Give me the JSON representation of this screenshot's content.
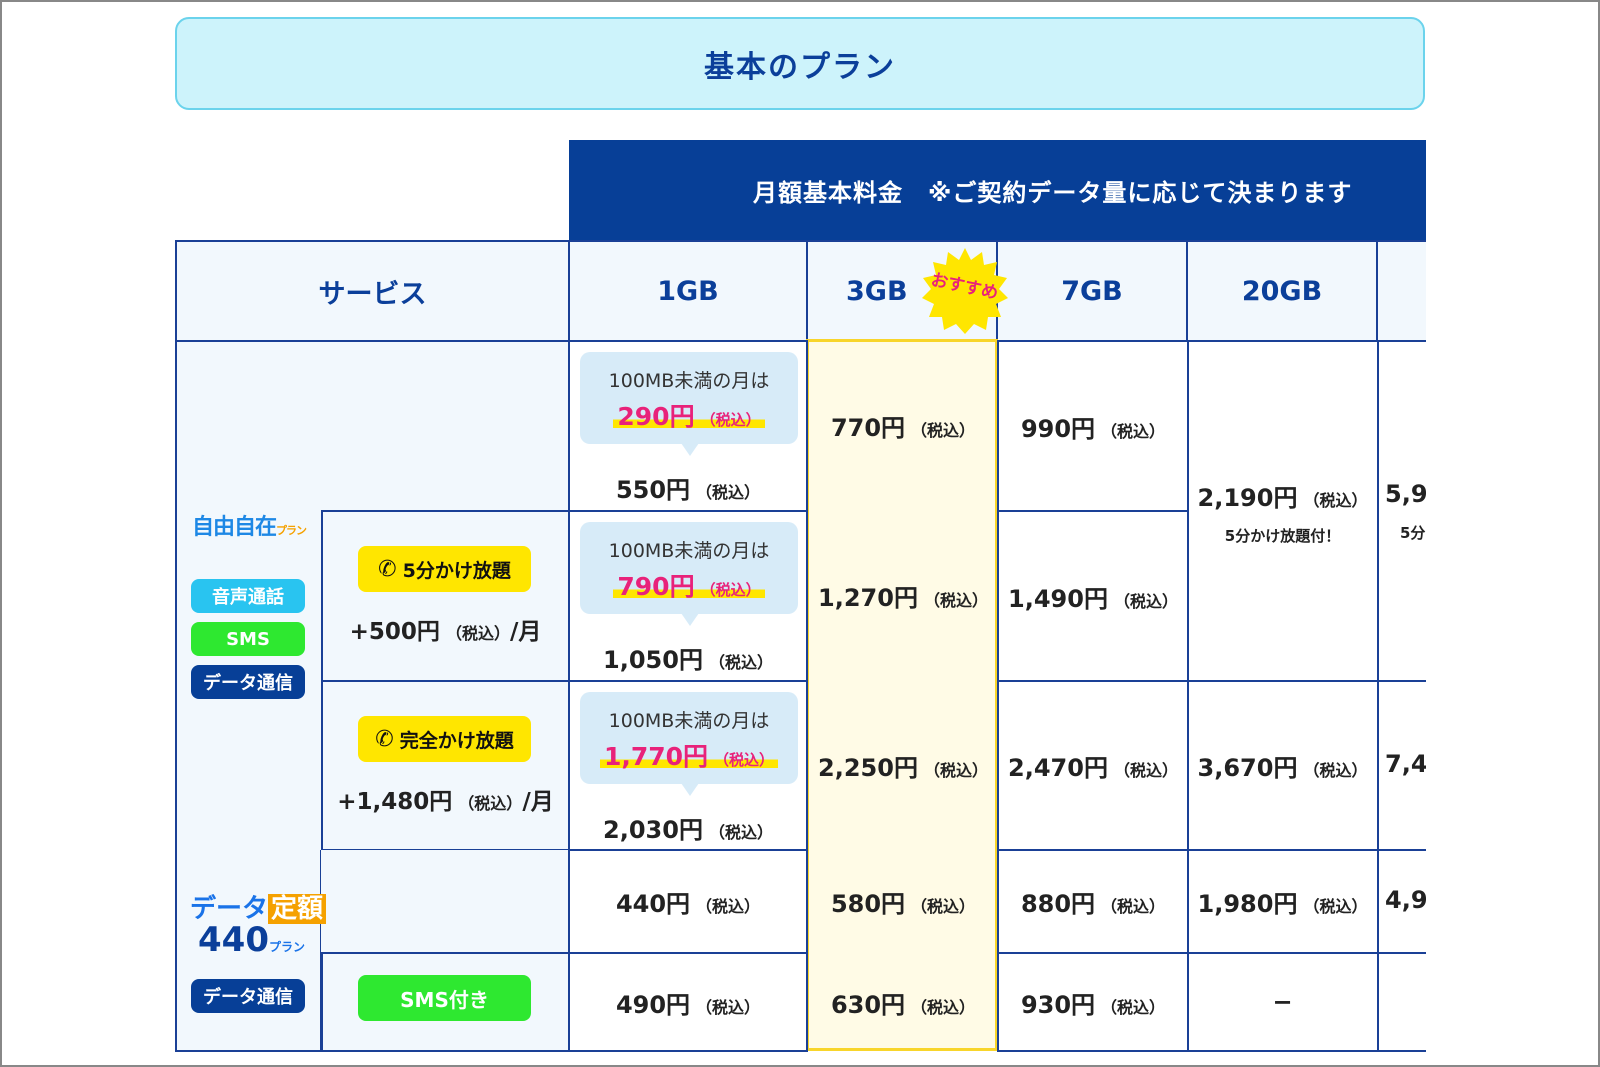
{
  "banner": {
    "title": "基本のプラン"
  },
  "header": {
    "monthly_fee": "月額基本料金　※ご契約データ量に応じて決まります"
  },
  "columns": {
    "service": "サービス",
    "c1": "1GB",
    "c2": "3GB",
    "c3": "7GB",
    "c4": "20GB"
  },
  "badge": {
    "label": "おすすめ"
  },
  "tax": "（税込）",
  "plan1": {
    "logo": "自由自在",
    "logo_suffix": "プラン",
    "tags": [
      "音声通話",
      "SMS",
      "データ通信"
    ],
    "row1": {
      "bubble_caption": "100MB未満の月は",
      "bubble_price": "290円",
      "c1": "550円",
      "c2": "770円",
      "c3": "990円"
    },
    "row2": {
      "option_label": "5分かけ放題",
      "option_price": "+500円",
      "option_suffix": "/月",
      "bubble_caption": "100MB未満の月は",
      "bubble_price": "790円",
      "c1": "1,050円",
      "c2": "1,270円",
      "c3": "1,490円"
    },
    "row3": {
      "option_label": "完全かけ放題",
      "option_price": "+1,480円",
      "option_suffix": "/月",
      "bubble_caption": "100MB未満の月は",
      "bubble_price": "1,770円",
      "c1": "2,030円",
      "c2": "2,250円",
      "c3": "2,470円",
      "c4": "3,670円",
      "c5": "7,4"
    },
    "merged_20gb": {
      "price": "2,190円",
      "note": "5分かけ放題付！"
    },
    "merged_next": {
      "price": "5,9",
      "note": "5分"
    }
  },
  "plan2": {
    "logo_a": "データ",
    "logo_box": "定額",
    "logo_b": "440",
    "logo_suffix": "プラン",
    "tag": "データ通信",
    "row1": {
      "c1": "440円",
      "c2": "580円",
      "c3": "880円",
      "c4": "1,980円",
      "c5": "4,9"
    },
    "row2": {
      "option_label": "SMS付き",
      "c1": "490円",
      "c2": "630円",
      "c3": "930円",
      "c4": "−"
    }
  },
  "colors": {
    "navy": "#073f97",
    "pink": "#e8227a",
    "yellow": "#ffe600",
    "green": "#2ee830",
    "cyan": "#29c4f0"
  }
}
